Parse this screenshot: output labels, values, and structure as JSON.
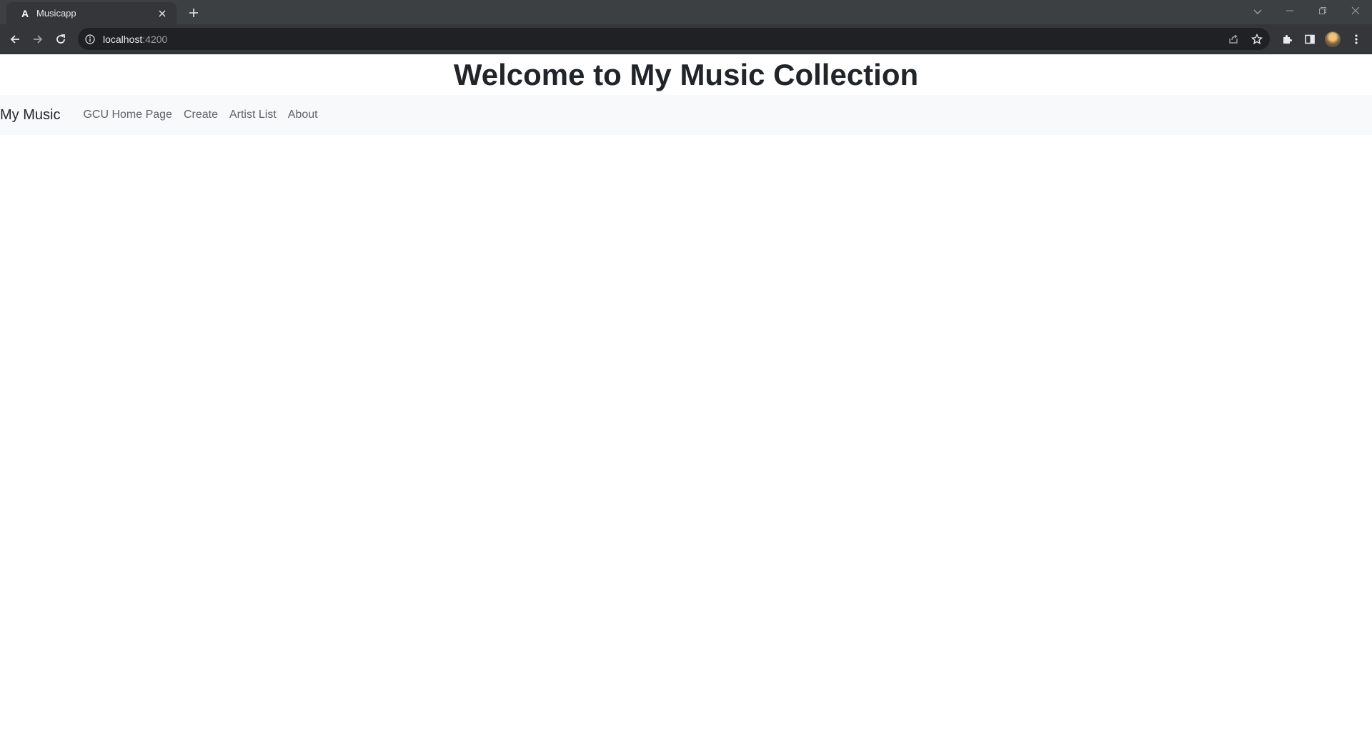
{
  "browser": {
    "tab": {
      "title": "Musicapp",
      "favicon_letter": "A"
    },
    "address_bar": {
      "host": "localhost",
      "port": ":4200"
    },
    "icons": {
      "back": "back-arrow-icon",
      "forward": "forward-arrow-icon",
      "reload": "reload-icon",
      "info": "site-info-icon",
      "share": "share-icon",
      "bookmark": "star-icon",
      "extensions": "puzzle-icon",
      "side_panel": "side-panel-icon",
      "menu": "kebab-menu-icon"
    },
    "colors": {
      "tabstrip": "#3c4043",
      "toolbar": "#35363a",
      "omnibox": "#202124"
    }
  },
  "page": {
    "title": "Welcome to My Music Collection",
    "navbar": {
      "brand": "My Music",
      "links": [
        {
          "label": "GCU Home Page"
        },
        {
          "label": "Create"
        },
        {
          "label": "Artist List"
        },
        {
          "label": "About"
        }
      ]
    },
    "colors": {
      "navbar_bg": "#f8f9fa",
      "text": "#212529",
      "link": "#5e6367"
    }
  }
}
